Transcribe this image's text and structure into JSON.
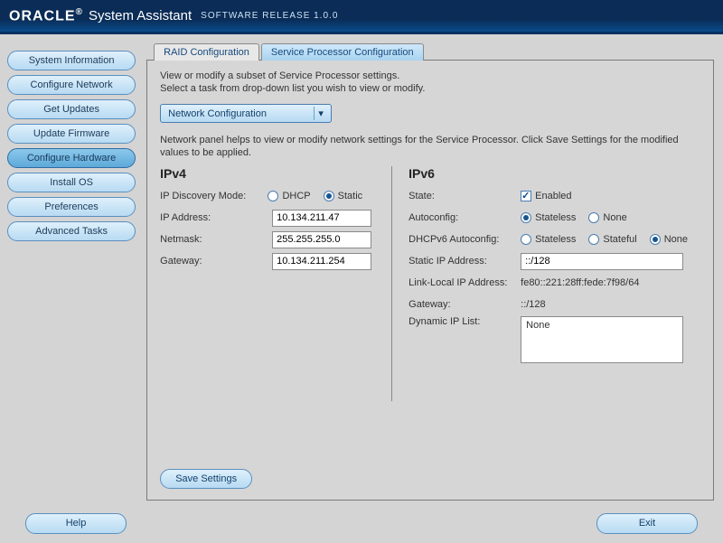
{
  "header": {
    "logo": "ORACLE",
    "product": "System Assistant",
    "subtitle": "SOFTWARE RELEASE  1.0.0"
  },
  "sidebar": {
    "items": [
      {
        "label": "System Information"
      },
      {
        "label": "Configure Network"
      },
      {
        "label": "Get Updates"
      },
      {
        "label": "Update Firmware"
      },
      {
        "label": "Configure Hardware",
        "active": true
      },
      {
        "label": "Install OS"
      },
      {
        "label": "Preferences"
      },
      {
        "label": "Advanced Tasks"
      }
    ]
  },
  "tabs": [
    {
      "label": "RAID Configuration"
    },
    {
      "label": "Service Processor Configuration",
      "active": true
    }
  ],
  "panel": {
    "desc_line1": "View or modify a subset of Service Processor settings.",
    "desc_line2": "Select a task from drop-down list you wish to view or modify.",
    "task_selected": "Network Configuration",
    "hint": "Network panel helps to view or modify network settings for the Service Processor. Click Save Settings for the modified values to be applied.",
    "save_label": "Save Settings"
  },
  "ipv4": {
    "heading": "IPv4",
    "discovery_label": "IP Discovery Mode:",
    "dhcp": "DHCP",
    "static": "Static",
    "ip_label": "IP Address:",
    "ip": "10.134.211.47",
    "netmask_label": "Netmask:",
    "netmask": "255.255.255.0",
    "gateway_label": "Gateway:",
    "gateway": "10.134.211.254"
  },
  "ipv6": {
    "heading": "IPv6",
    "state_label": "State:",
    "enabled": "Enabled",
    "autoconfig_label": "Autoconfig:",
    "stateless": "Stateless",
    "none": "None",
    "dhcpv6_label": "DHCPv6 Autoconfig:",
    "stateful": "Stateful",
    "static_ip_label": "Static IP Address:",
    "static_ip": "::/128",
    "link_local_label": "Link-Local IP Address:",
    "link_local": "fe80::221:28ff:fede:7f98/64",
    "gateway_label": "Gateway:",
    "gateway": "::/128",
    "dyn_label": "Dynamic IP List:",
    "dyn_list": "None"
  },
  "footer": {
    "help": "Help",
    "exit": "Exit"
  }
}
